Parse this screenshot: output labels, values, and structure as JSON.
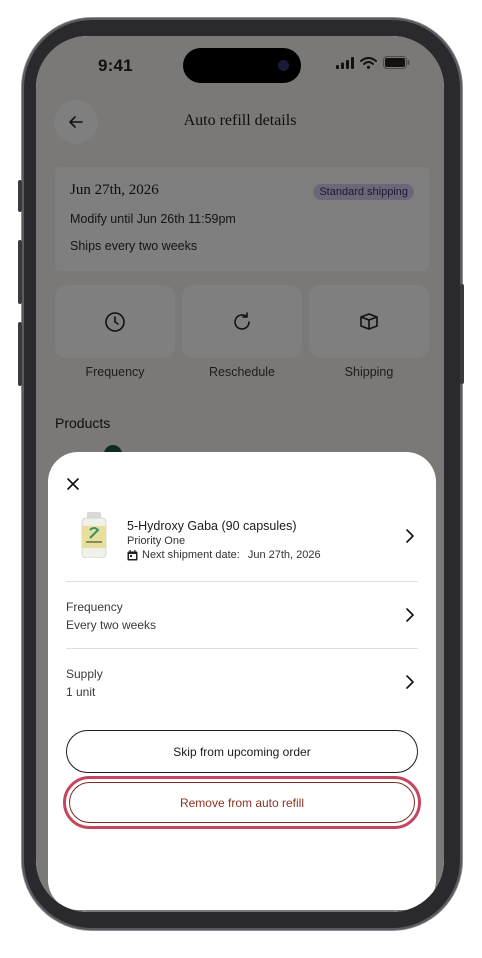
{
  "status_bar": {
    "time": "9:41"
  },
  "header": {
    "title": "Auto refill details"
  },
  "summary": {
    "date": "Jun 27th, 2026",
    "badge": "Standard shipping",
    "modify_until": "Modify until Jun 26th 11:59pm",
    "ships": "Ships every two weeks"
  },
  "actions": [
    {
      "label": "Frequency",
      "icon": "clock-icon"
    },
    {
      "label": "Reschedule",
      "icon": "refresh-icon"
    },
    {
      "label": "Shipping",
      "icon": "box-icon"
    }
  ],
  "products_heading": "Products",
  "sheet": {
    "product": {
      "name": "5-Hydroxy Gaba (90 capsules)",
      "brand": "Priority One",
      "shipment_label": "Next shipment date:",
      "shipment_date": "Jun 27th, 2026"
    },
    "frequency": {
      "label": "Frequency",
      "value": "Every two weeks"
    },
    "supply": {
      "label": "Supply",
      "value": "1 unit"
    },
    "skip_button": "Skip from upcoming order",
    "remove_button": "Remove from auto refill"
  },
  "colors": {
    "badge_bg": "#d9cff0",
    "remove_text": "#8a3222",
    "highlight_ring": "#c4465e"
  }
}
